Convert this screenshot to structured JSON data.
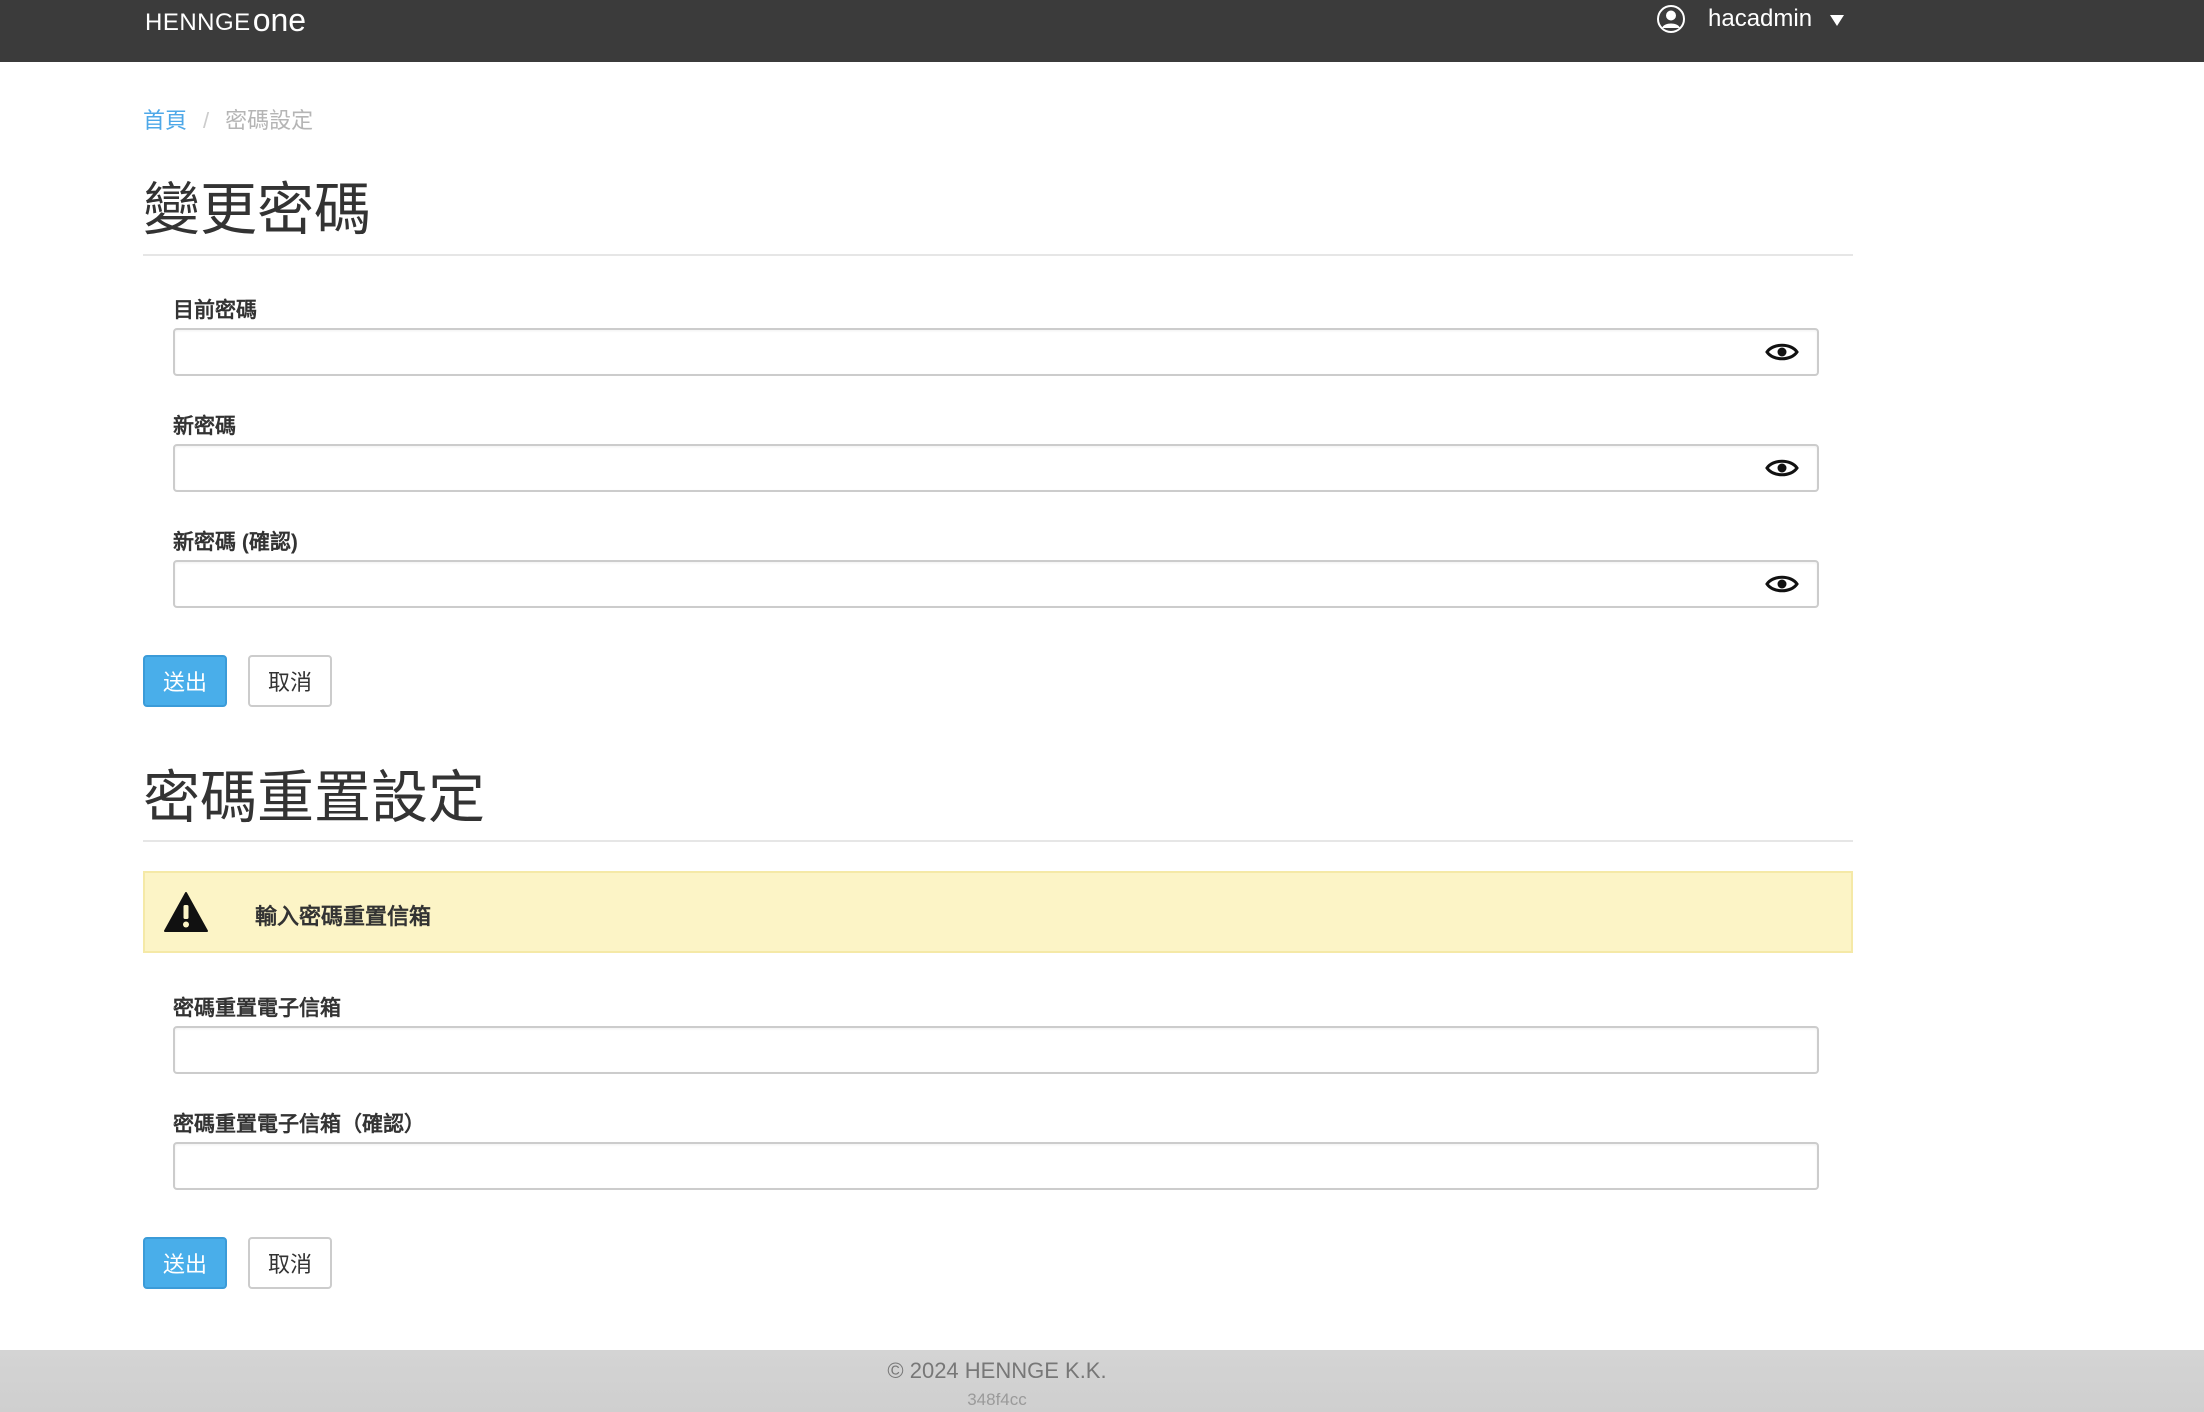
{
  "navbar": {
    "brand_main": "HENNGE",
    "brand_suffix": "one",
    "username": "hacadmin"
  },
  "breadcrumb": {
    "home": "首頁",
    "separator": "/",
    "current": "密碼設定"
  },
  "change_password": {
    "title": "變更密碼",
    "current_password_label": "目前密碼",
    "current_password_value": "",
    "new_password_label": "新密碼",
    "new_password_value": "",
    "confirm_password_label": "新密碼 (確認)",
    "confirm_password_value": "",
    "submit_label": "送出",
    "cancel_label": "取消"
  },
  "reset_settings": {
    "title": "密碼重置設定",
    "alert_text": "輸入密碼重置信箱",
    "email_label": "密碼重置電子信箱",
    "email_value": "",
    "email_confirm_label": "密碼重置電子信箱（確認）",
    "email_confirm_value": "",
    "submit_label": "送出",
    "cancel_label": "取消"
  },
  "footer": {
    "copyright": "© 2024 HENNGE K.K.",
    "build": "348f4cc"
  },
  "icons": {
    "user": "user-circle-icon",
    "caret": "caret-down-icon",
    "eye": "eye-icon",
    "warning": "warning-triangle-icon"
  },
  "colors": {
    "navbar_bg": "#3b3b3b",
    "link": "#4ea8e8",
    "primary_button": "#49aeea",
    "alert_bg": "#fcf4c6",
    "footer_bg": "#d2d2d2"
  }
}
